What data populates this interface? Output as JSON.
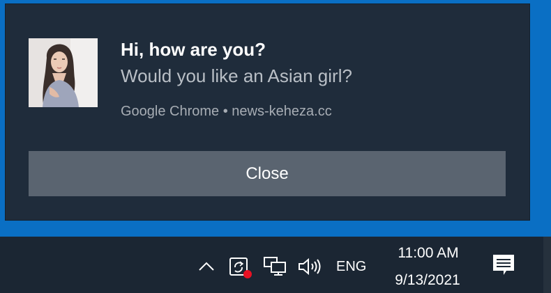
{
  "notification": {
    "title": "Hi, how are you?",
    "message": "Would you like an Asian girl?",
    "attribution": "Google Chrome • news-keheza.cc",
    "close_label": "Close",
    "icon": "profile-photo"
  },
  "taskbar": {
    "show_hidden_icon": "chevron-up-icon",
    "language": "ENG",
    "time": "11:00 AM",
    "date": "9/13/2021",
    "action_center_icon": "notification-icon"
  },
  "colors": {
    "desktop": "#0a6fc4",
    "toast_background": "#1f2c3b",
    "close_button": "#5a6470",
    "taskbar": "#1b2633",
    "badge_red": "#e81123"
  }
}
